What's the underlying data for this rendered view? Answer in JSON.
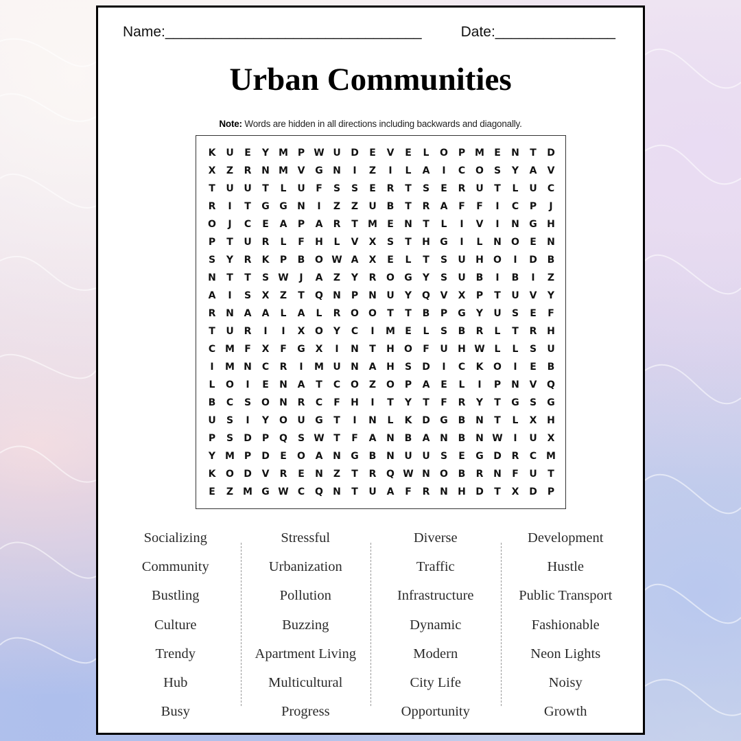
{
  "header": {
    "name_label": "Name:________________________________",
    "date_label": "Date:_______________"
  },
  "title": "Urban Communities",
  "note": {
    "bold": "Note:",
    "text": " Words are hidden in all directions including backwards and diagonally."
  },
  "grid": [
    "KUEYMPWUDEVELOPMENTD",
    "XZRNMVGNIZILAICOSYAV",
    "TUUTLUFSSERTSERUTLUC",
    "RITGGNIZZUBTRAFFICPJ",
    "OJCEAPARTMENTLIVINGH",
    "PTURLFHLVXSTHGILNOEN",
    "SYRKPBOWAXELTSUHOIDB",
    "NTTSWJAZYROGYSUBIBIZ",
    "AISXZTQNPNUYQVXPTUVY",
    "RNAALALROOTTBPGYUSEF",
    "TURIIXOYCIMELSBRLTRH",
    "CMFXFGXINTHOFUHWLLSU",
    "IMNCRIMUNAHSDICKOIEB",
    "LOIENATCOZOPAELIPNVQ",
    "BCSONRCFHITYTFRYTGSG",
    "USIYOUGTINLKDGBNTLXH",
    "PSDPQSWTFANBANBNWIUX",
    "YMPDEOANGBNUUSEGDRCM",
    "KODVRENZTRQWNOBRNFUT",
    "EZMGWCQNTUAFRNHDTXDP"
  ],
  "word_columns": [
    [
      "Socializing",
      "Community",
      "Bustling",
      "Culture",
      "Trendy",
      "Hub",
      "Busy"
    ],
    [
      "Stressful",
      "Urbanization",
      "Pollution",
      "Buzzing",
      "Apartment Living",
      "Multicultural",
      "Progress"
    ],
    [
      "Diverse",
      "Traffic",
      "Infrastructure",
      "Dynamic",
      "Modern",
      "City Life",
      "Opportunity"
    ],
    [
      "Development",
      "Hustle",
      "Public Transport",
      "Fashionable",
      "Neon Lights",
      "Noisy",
      "Growth"
    ]
  ]
}
